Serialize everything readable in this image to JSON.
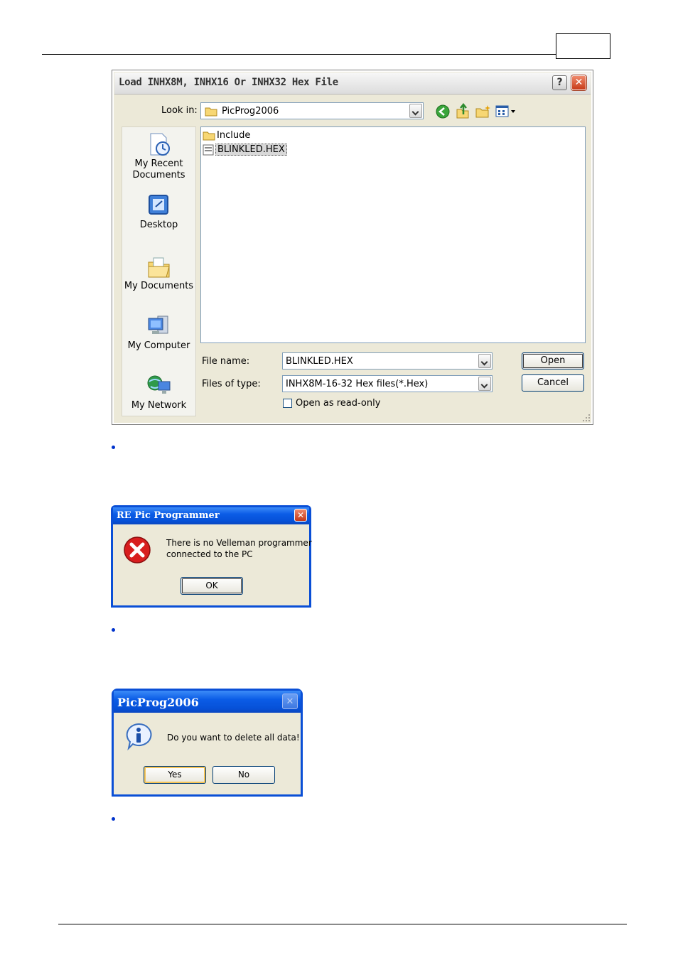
{
  "open_dialog": {
    "title": "Load INHX8M, INHX16 Or INHX32 Hex File",
    "help_label": "?",
    "look_in_label": "Look in:",
    "look_in_value": "PicProg2006",
    "places": [
      {
        "label": "My Recent Documents",
        "icon": "recent-documents-icon"
      },
      {
        "label": "Desktop",
        "icon": "desktop-icon"
      },
      {
        "label": "My Documents",
        "icon": "my-documents-icon"
      },
      {
        "label": "My Computer",
        "icon": "my-computer-icon"
      },
      {
        "label": "My Network",
        "icon": "my-network-icon"
      }
    ],
    "files": [
      {
        "name": "Include",
        "type": "folder"
      },
      {
        "name": "BLINKLED.HEX",
        "type": "file",
        "selected": true
      }
    ],
    "file_name_label": "File name:",
    "file_name_value": "BLINKLED.HEX",
    "files_of_type_label": "Files of type:",
    "files_of_type_value": "INHX8M-16-32 Hex files(*.Hex)",
    "open_readonly_label": "Open as read-only",
    "open_button": "Open",
    "cancel_button": "Cancel"
  },
  "error_dialog": {
    "title": "RE Pic Programmer",
    "message_line1": "There is no Velleman programmer",
    "message_line2": "connected to the PC",
    "ok_button": "OK"
  },
  "confirm_dialog": {
    "title": "PicProg2006",
    "message": "Do you want to delete all data!",
    "yes_button": "Yes",
    "no_button": "No"
  },
  "colors": {
    "xp_title_blue": "#0b5ce6",
    "dialog_face": "#ece9d8",
    "bullet_blue": "#0033cc"
  }
}
